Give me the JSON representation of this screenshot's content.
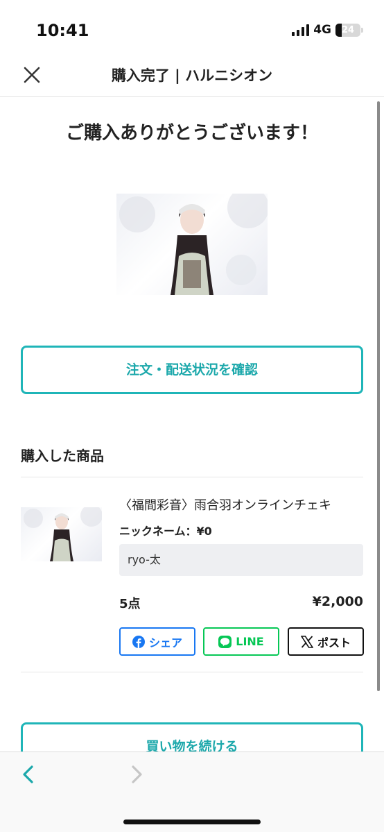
{
  "status_bar": {
    "time": "10:41",
    "network": "4G",
    "battery": "24"
  },
  "header": {
    "title": "購入完了 | ハルニシオン",
    "close_icon": "close-icon"
  },
  "main": {
    "thanks_message": "ご購入ありがとうございます！",
    "order_status_button": "注文・配送状況を確認",
    "purchased_section_title": "購入した商品",
    "continue_button": "買い物を続ける"
  },
  "product": {
    "name": "〈福間彩音〉雨合羽オンラインチェキ",
    "nickname_label": "ニックネーム：¥0",
    "nickname_value": "ryo-太",
    "quantity": "5点",
    "price": "¥2,000"
  },
  "share": {
    "facebook_label": "シェア",
    "line_label": "LINE",
    "x_label": "ポスト"
  },
  "colors": {
    "accent": "#1fb5b8",
    "facebook": "#1877f2",
    "line": "#06c755",
    "x": "#111111"
  },
  "toolbar": {
    "back_icon": "chevron-left-icon",
    "forward_icon": "chevron-right-icon"
  }
}
